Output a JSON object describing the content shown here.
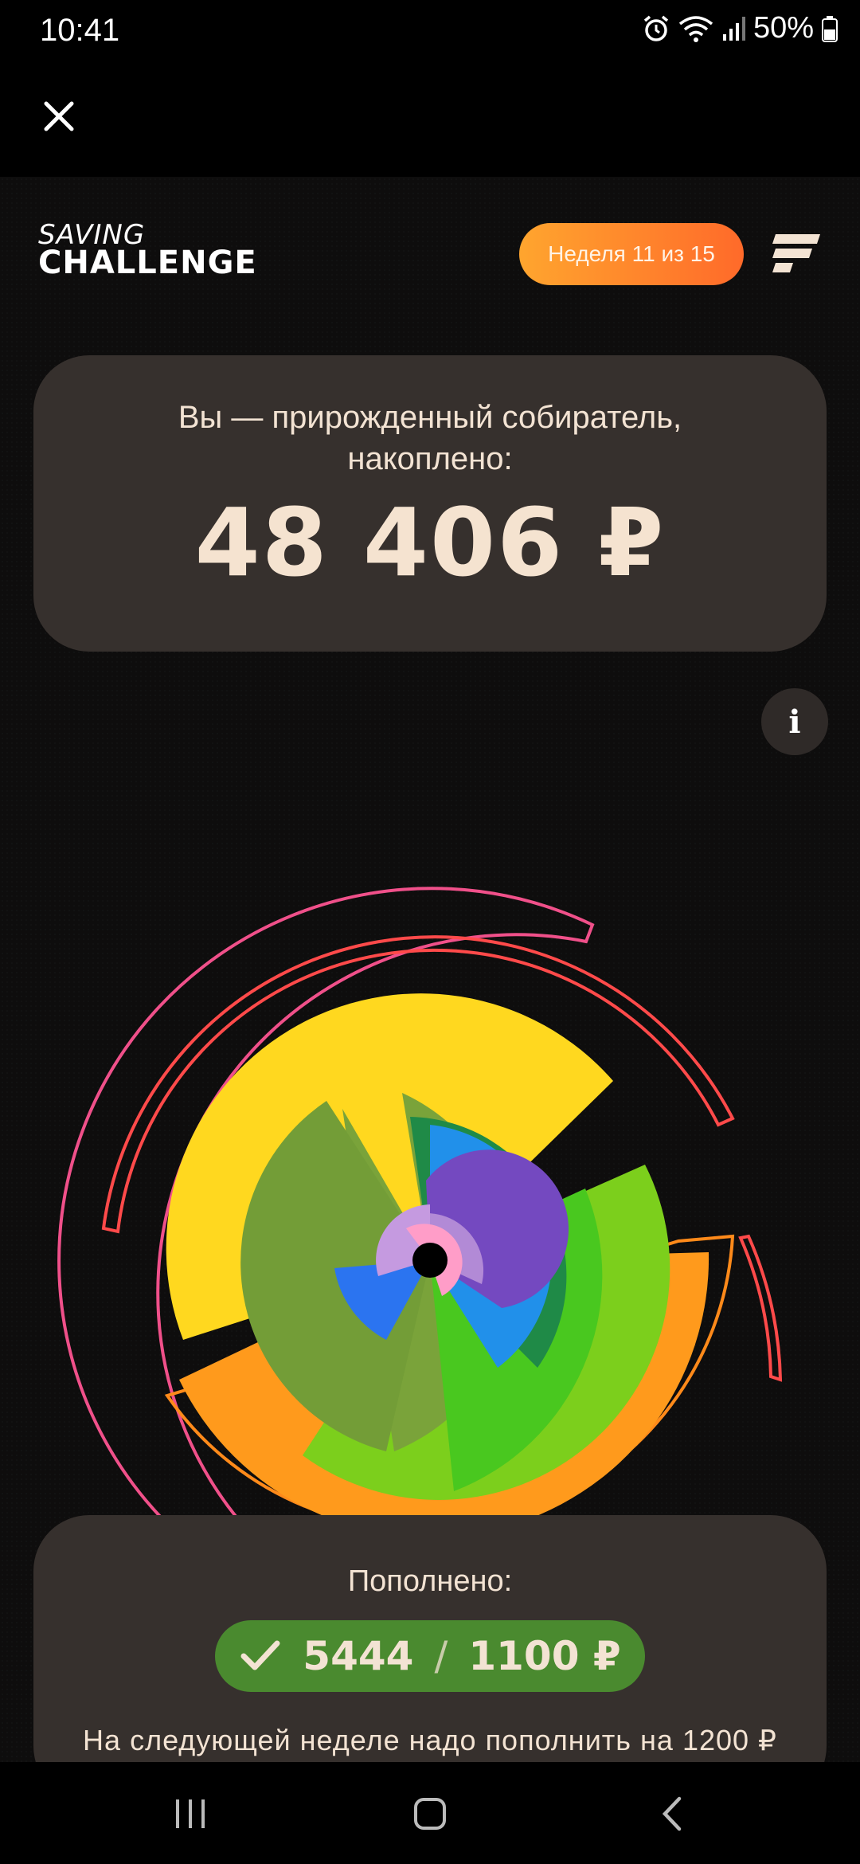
{
  "status_bar": {
    "time": "10:41",
    "battery": "50%",
    "icons": [
      "alarm-icon",
      "wifi-icon",
      "signal-icon",
      "battery-icon"
    ]
  },
  "top_bar": {
    "close_icon": "close-icon"
  },
  "header": {
    "logo_top": "SAVING",
    "logo_bottom": "CHALLENGE",
    "week_label": "Неделя 11 из 15",
    "menu_icon": "menu-icon"
  },
  "summary": {
    "line1": "Вы — прирожденный собиратель,",
    "line2": "накоплено:",
    "amount": "48 406 ₽"
  },
  "info_button": {
    "label": "i"
  },
  "colors": {
    "accent_orange": "#ff8a2a",
    "card_bg": "#36302d",
    "success_green": "#4a8a2f",
    "text_cream": "#f3e3d3"
  },
  "deposit": {
    "title": "Пополнено:",
    "check_icon": "check-icon",
    "current": "5444",
    "separator": "/",
    "target": "1100 ₽",
    "next_note": "На следующей неделе надо пополнить на 1200 ₽"
  },
  "nav_bar": {
    "icons": [
      "recent-apps-icon",
      "home-icon",
      "back-icon"
    ]
  }
}
